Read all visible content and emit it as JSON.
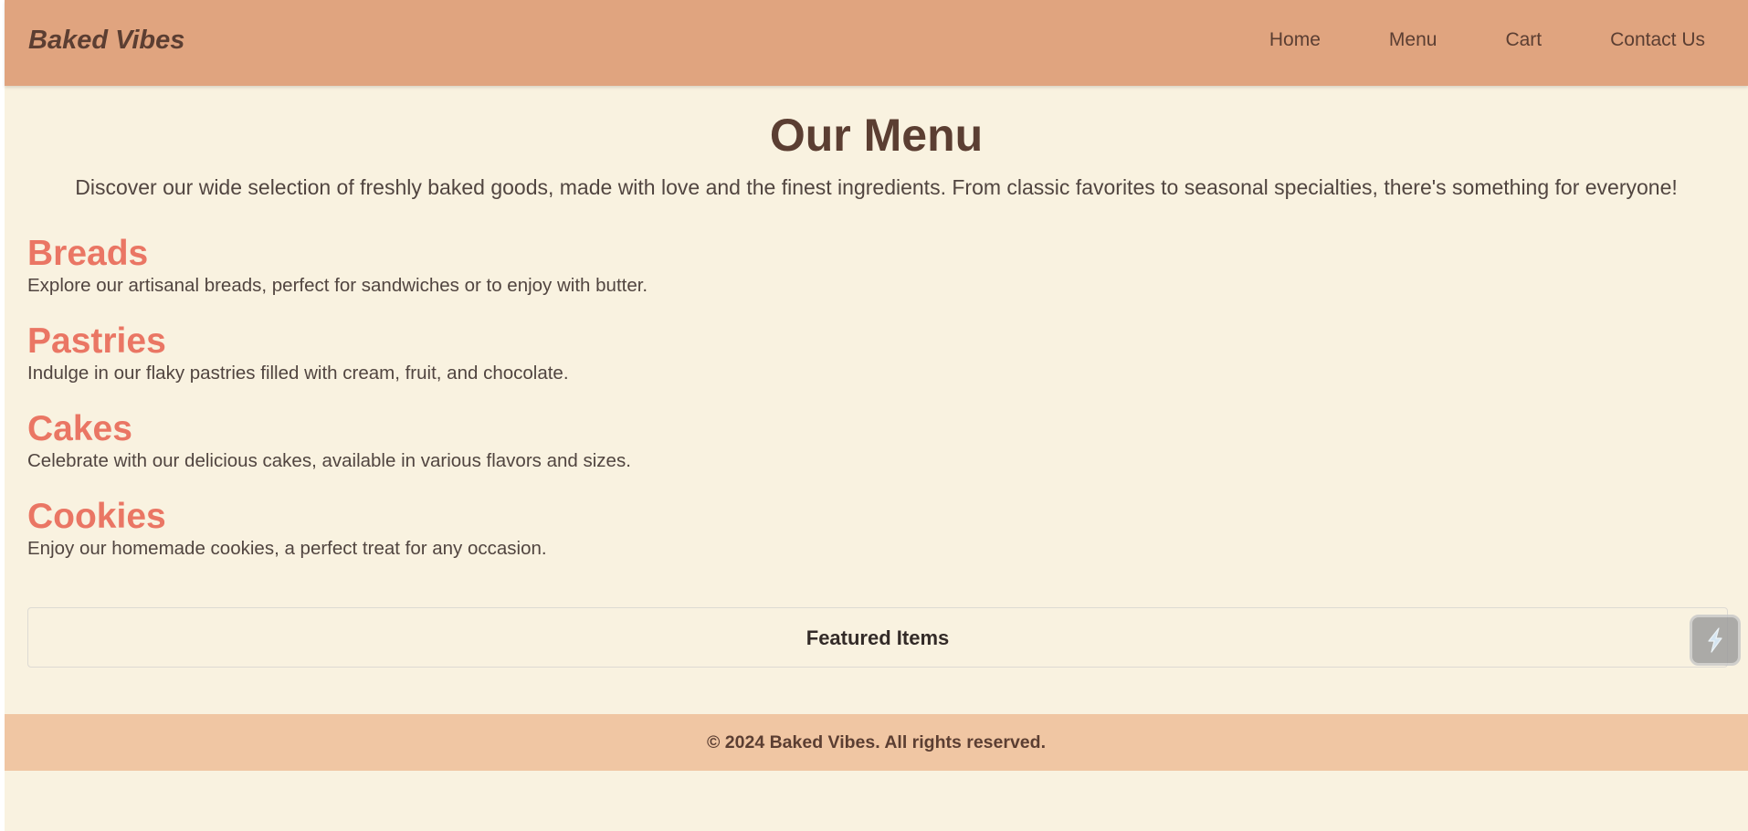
{
  "header": {
    "brand": "Baked Vibes",
    "nav": [
      {
        "label": "Home"
      },
      {
        "label": "Menu"
      },
      {
        "label": "Cart"
      },
      {
        "label": "Contact Us"
      }
    ]
  },
  "main": {
    "title": "Our Menu",
    "intro": "Discover our wide selection of freshly baked goods, made with love and the finest ingredients. From classic favorites to seasonal specialties, there's something for everyone!",
    "categories": [
      {
        "name": "Breads",
        "description": "Explore our artisanal breads, perfect for sandwiches or to enjoy with butter."
      },
      {
        "name": "Pastries",
        "description": "Indulge in our flaky pastries filled with cream, fruit, and chocolate."
      },
      {
        "name": "Cakes",
        "description": "Celebrate with our delicious cakes, available in various flavors and sizes."
      },
      {
        "name": "Cookies",
        "description": "Enjoy our homemade cookies, a perfect treat for any occasion."
      }
    ],
    "featured": {
      "title": "Featured Items"
    }
  },
  "footer": {
    "copyright": "© 2024 Baked Vibes. All rights reserved."
  },
  "theme": {
    "header_bg": "#e0a47f",
    "page_bg": "#f9f2e0",
    "footer_bg": "#f0c6a3",
    "accent": "#ea7664",
    "brown_text": "#5b3e32"
  },
  "icons": {
    "assistant": "lightning-bolt-icon"
  }
}
